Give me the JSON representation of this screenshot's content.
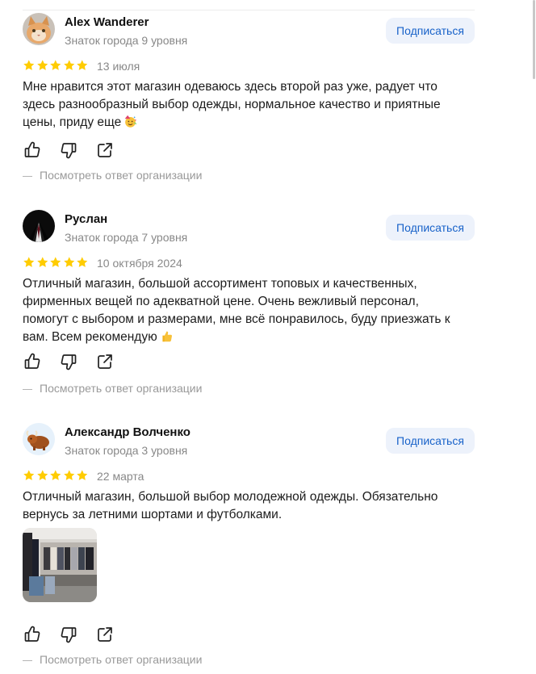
{
  "reviews": [
    {
      "author": "Alex Wanderer",
      "level": "Знаток города 9 уровня",
      "subscribe_label": "Подписаться",
      "rating": 5,
      "date": "13 июля",
      "text": "Мне нравится этот магазин одеваюсь здесь второй раз уже, радует что здесь разнообразный выбор одежды, нормальное качество и приятные цены, приду еще",
      "text_emoji": "party-face",
      "avatar": "cat-photo",
      "answer_label": "Посмотреть ответ организации"
    },
    {
      "author": "Руслан",
      "level": "Знаток города 7 уровня",
      "subscribe_label": "Подписаться",
      "rating": 5,
      "date": "10 октября 2024",
      "text": "Отличный магазин, большой ассортимент топовых и качественных, фирменных вещей по адекватной цене. Очень вежливый персонал, помогут с выбором и размерами, мне всё понравилось, буду приезжать к вам. Всем рекомендую",
      "text_emoji": "thumbs-up",
      "avatar": "suit-photo",
      "answer_label": "Посмотреть ответ организации"
    },
    {
      "author": "Александр Волченко",
      "level": "Знаток города 3 уровня",
      "subscribe_label": "Подписаться",
      "rating": 5,
      "date": "22 марта",
      "text": "Отличный магазин, большой выбор молодежной одежды. Обязательно вернусь за летними шортами и футболками.",
      "text_emoji": "",
      "avatar": "yak-illustration",
      "photo": "store-interior-photo",
      "answer_label": "Посмотреть ответ организации"
    }
  ],
  "colors": {
    "star": "#fc0",
    "subscribe_bg": "#edf2fb",
    "subscribe_text": "#1862c9",
    "muted_text": "#888888"
  }
}
